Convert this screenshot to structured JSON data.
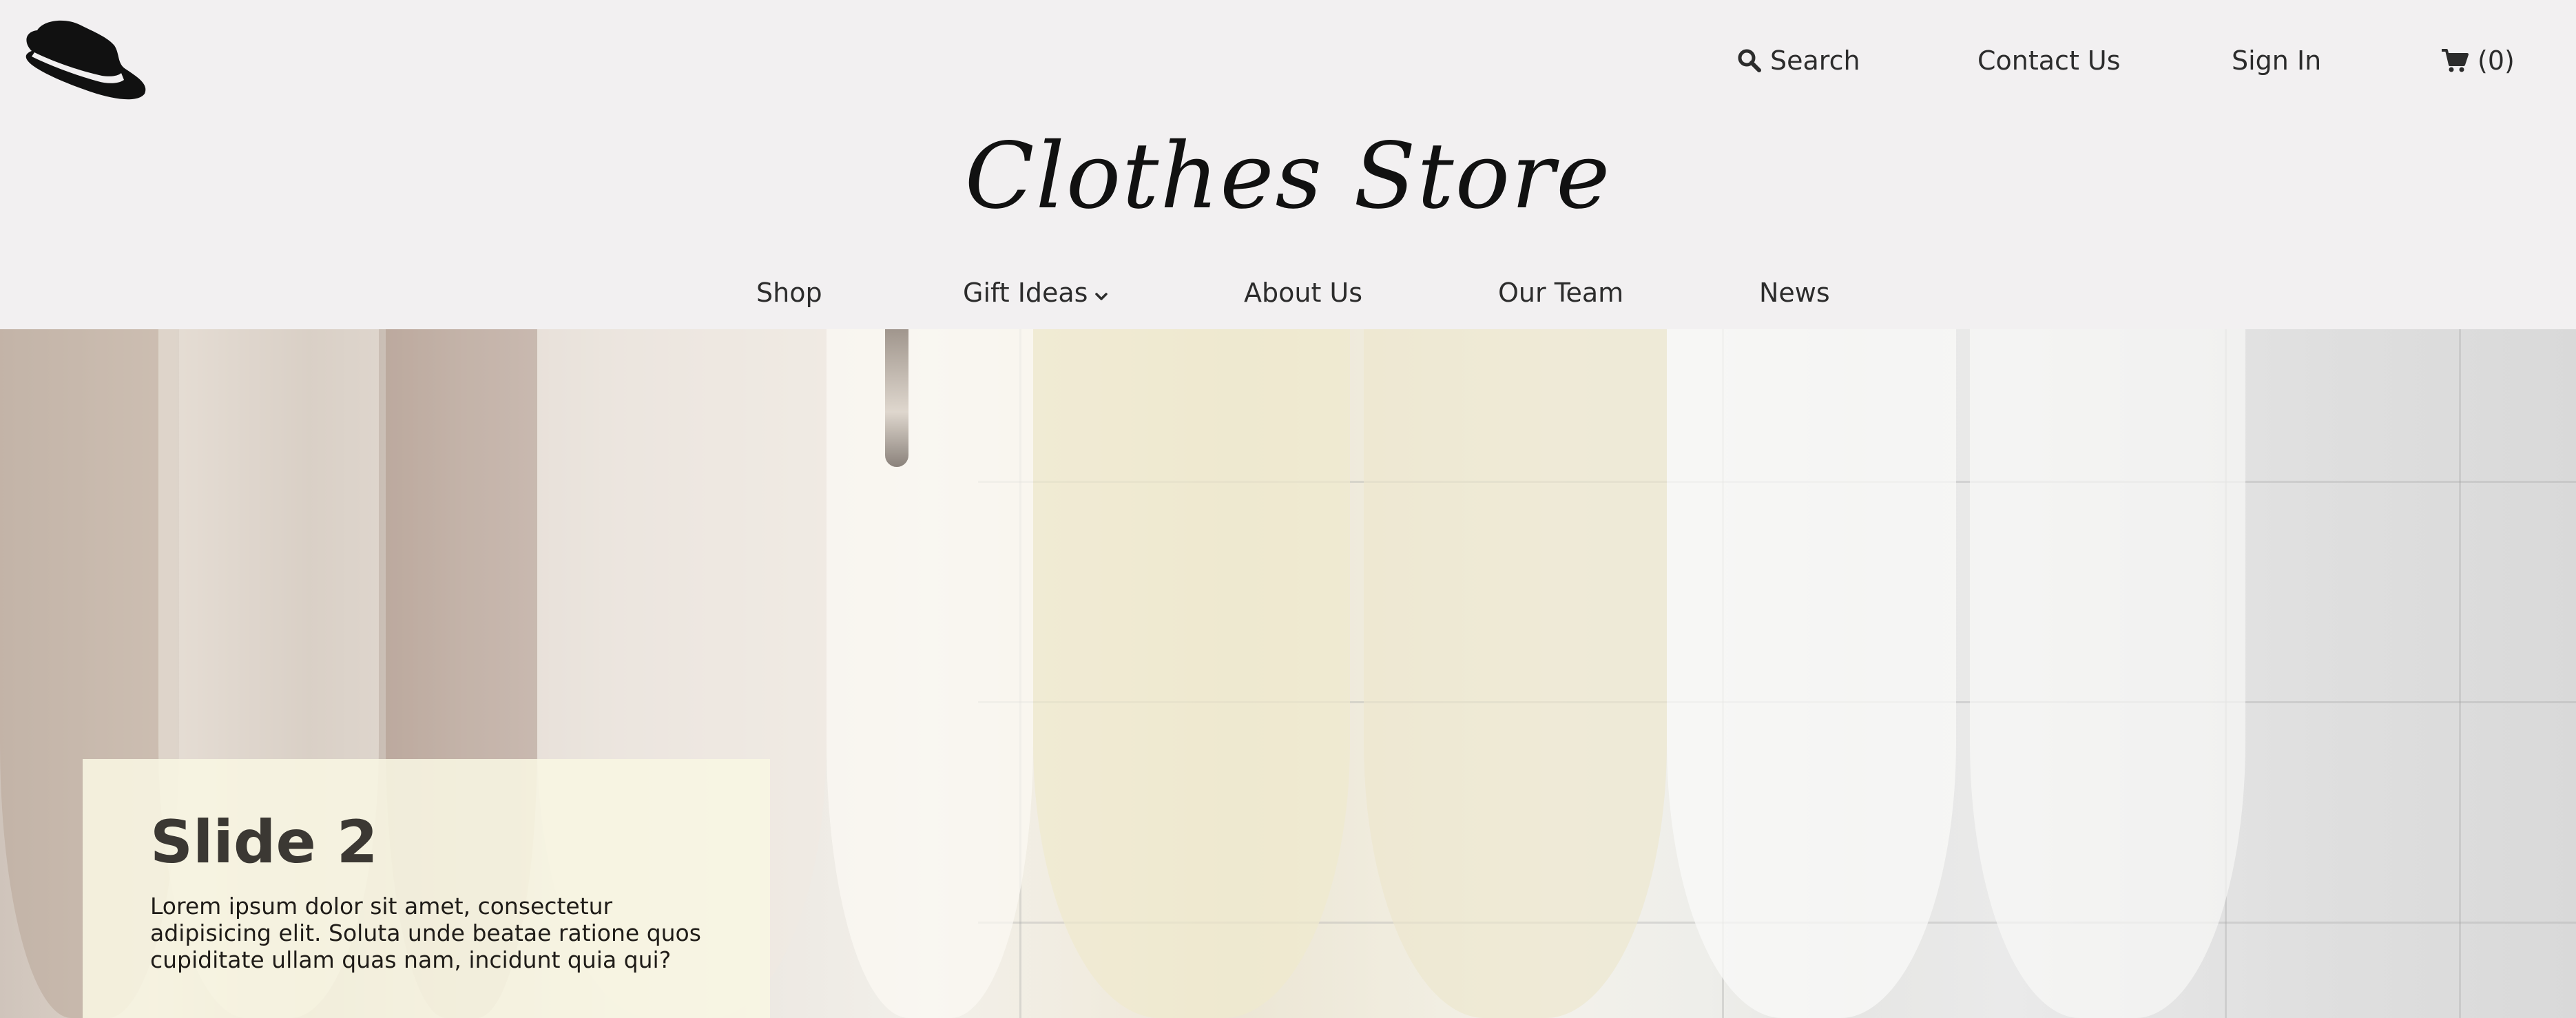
{
  "header": {
    "brand": "Clothes Store",
    "top_links": {
      "search": "Search",
      "contact": "Contact Us",
      "sign_in": "Sign In",
      "cart": "(0)"
    },
    "main_nav": {
      "shop": "Shop",
      "gift_ideas": "Gift Ideas",
      "about": "About Us",
      "team": "Our Team",
      "news": "News"
    },
    "icons": [
      "hat-logo-icon",
      "search-icon",
      "cart-icon",
      "chevron-down-icon"
    ]
  },
  "hero": {
    "slide_title": "Slide 2",
    "slide_text": "Lorem ipsum dolor sit amet, consectetur adipisicing elit. Soluta unde beatae ratione quos cupiditate ullam quas nam, incidunt quia qui?"
  },
  "colors": {
    "header_bg": "#f2f0f1",
    "text": "#2c2c2c",
    "card_bg": "#f8f6e2"
  }
}
